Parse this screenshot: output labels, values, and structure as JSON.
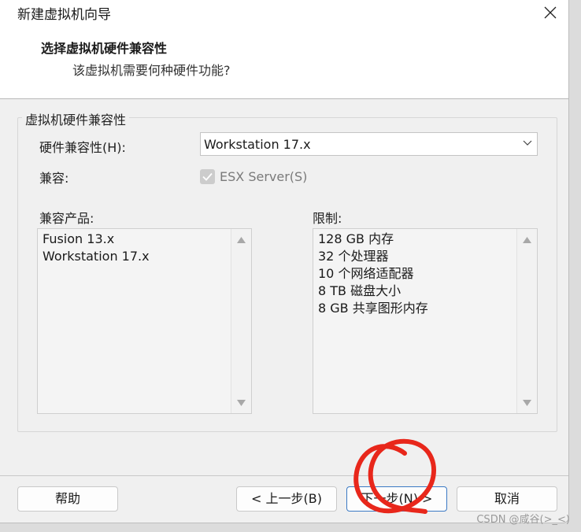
{
  "window": {
    "title": "新建虚拟机向导"
  },
  "header": {
    "title": "选择虚拟机硬件兼容性",
    "subtitle": "该虚拟机需要何种硬件功能?"
  },
  "group": {
    "legend": "虚拟机硬件兼容性",
    "hw_compat_label": "硬件兼容性(H):",
    "hw_compat_value": "Workstation 17.x",
    "compat_label": "兼容:",
    "esx_label": "ESX Server(S)",
    "products_label": "兼容产品:",
    "products": [
      "Fusion 13.x",
      "Workstation 17.x"
    ],
    "limits_label": "限制:",
    "limits": [
      "128 GB 内存",
      "32 个处理器",
      "10 个网络适配器",
      "8 TB 磁盘大小",
      "8 GB 共享图形内存"
    ]
  },
  "buttons": {
    "help": "帮助",
    "back": "< 上一步(B)",
    "next": "下一步(N) >",
    "cancel": "取消"
  },
  "watermark": "CSDN @咸谷(>_<)",
  "colors": {
    "annotation": "#e8271b",
    "primary_border": "#3b79c4"
  }
}
